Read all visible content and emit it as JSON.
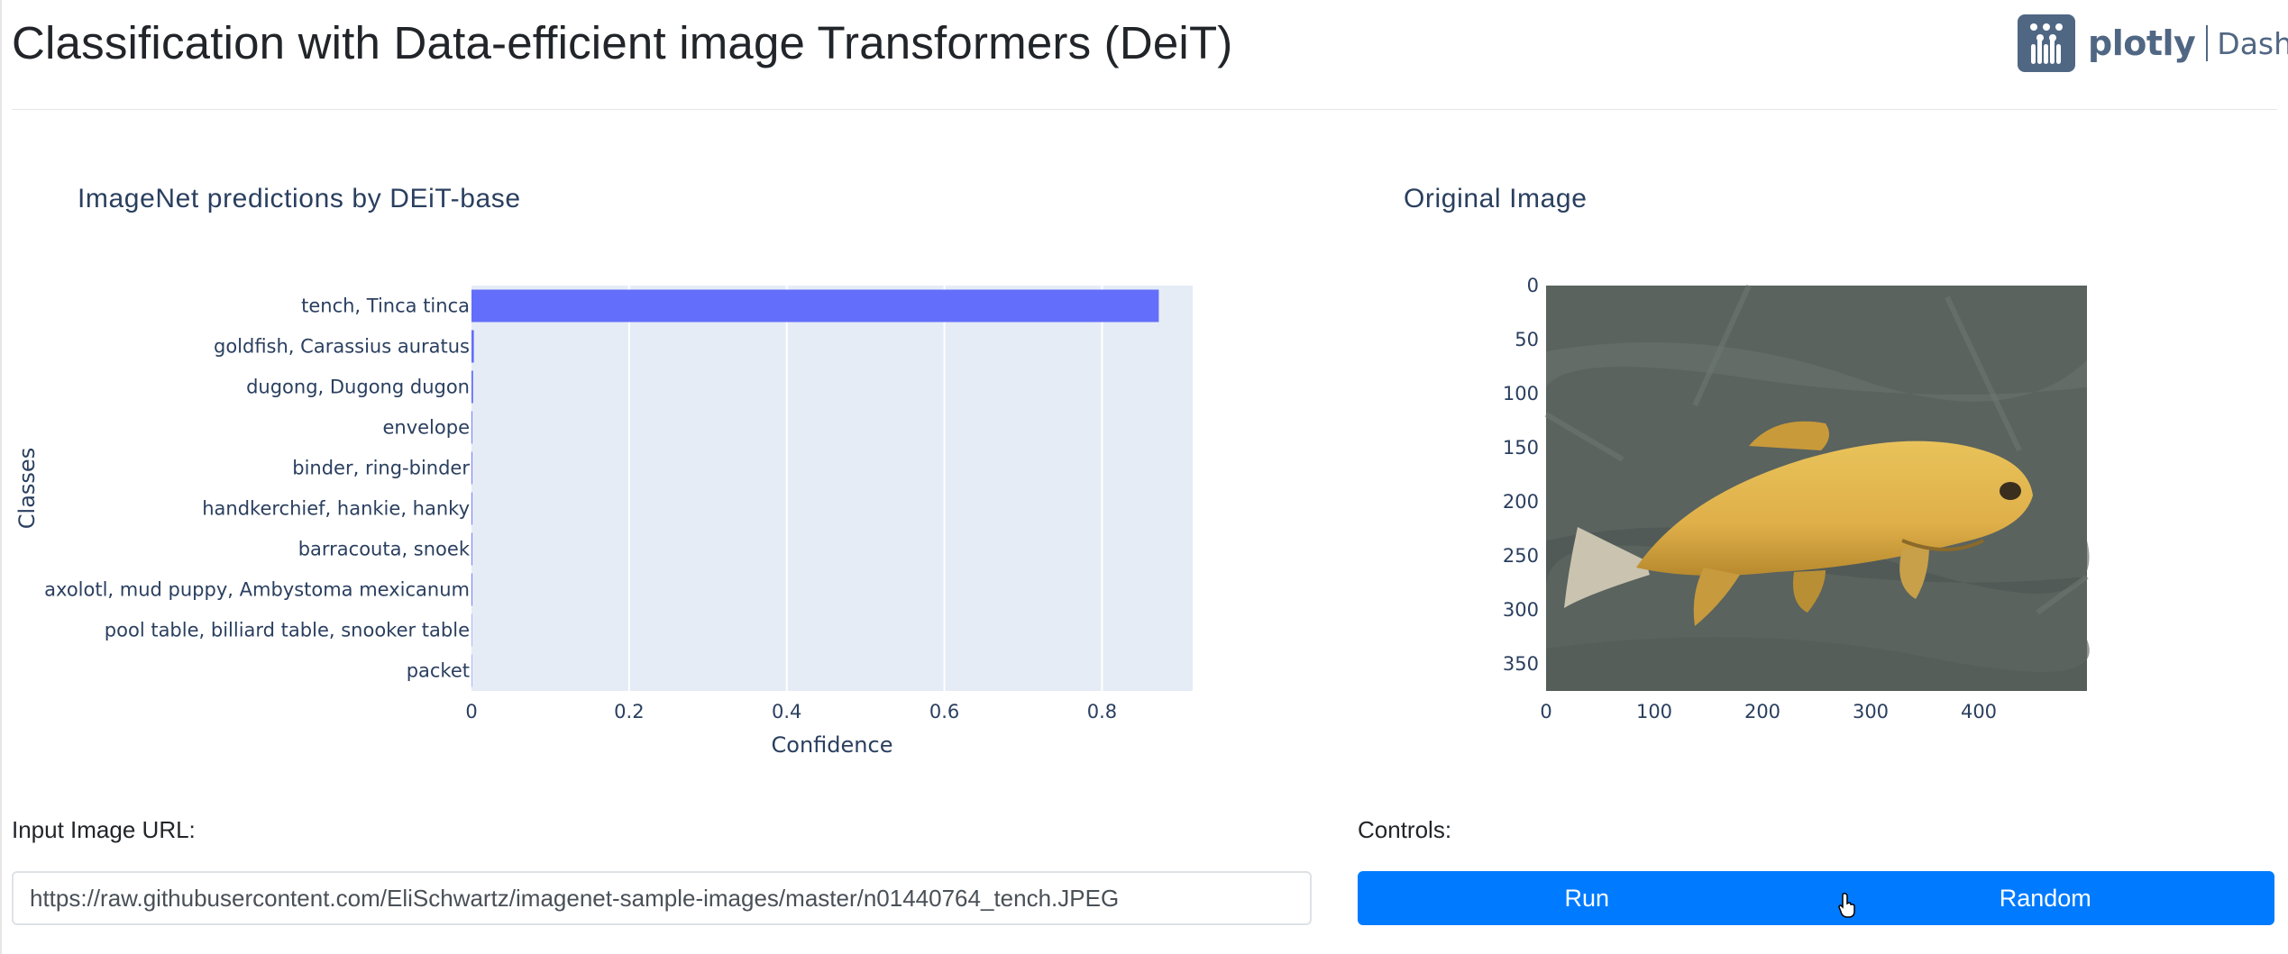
{
  "header": {
    "title": "Classification with Data-efficient image Transformers (DeiT)",
    "logo_text": "plotly",
    "logo_product": "Dash",
    "logo_color": "#506784"
  },
  "prediction_graph": {
    "title": "ImageNet predictions by DEiT-base",
    "bar_color": "#636efa",
    "plot_bg": "#e5ecf6"
  },
  "image_graph": {
    "title": "Original Image",
    "x_ticks": [
      "0",
      "100",
      "200",
      "300",
      "400"
    ],
    "y_ticks": [
      "0",
      "50",
      "100",
      "150",
      "200",
      "250",
      "300",
      "350"
    ]
  },
  "chart_data": {
    "type": "bar",
    "orientation": "horizontal",
    "title": "ImageNet predictions by DEiT-base",
    "xlabel": "Confidence",
    "ylabel": "Classes",
    "xlim": [
      0,
      0.915
    ],
    "x_ticks": [
      "0",
      "0.2",
      "0.4",
      "0.6",
      "0.8"
    ],
    "grid": true,
    "categories": [
      "tench, Tinca tinca",
      "goldfish, Carassius auratus",
      "dugong, Dugong dugon",
      "envelope",
      "binder, ring-binder",
      "handkerchief, hankie, hanky",
      "barracouta, snoek",
      "axolotl, mud puppy, Ambystoma mexicanum",
      "pool table, billiard table, snooker table",
      "packet"
    ],
    "values": [
      0.872,
      0.003,
      0.002,
      0.001,
      0.001,
      0.001,
      0.001,
      0.001,
      0.0005,
      0.0005
    ]
  },
  "input": {
    "label": "Input Image URL:",
    "value": "https://raw.githubusercontent.com/EliSchwartz/imagenet-sample-images/master/n01440764_tench.JPEG"
  },
  "controls": {
    "label": "Controls:",
    "run_label": "Run",
    "random_label": "Random",
    "button_color": "#007bff"
  }
}
